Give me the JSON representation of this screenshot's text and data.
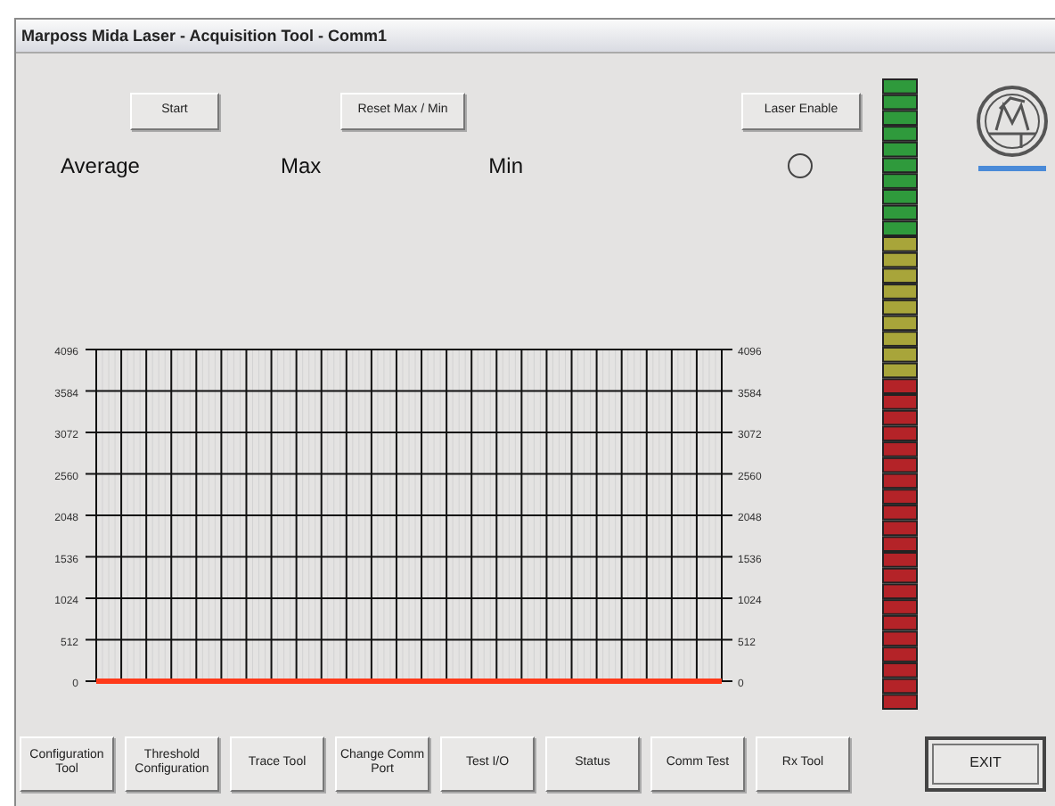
{
  "window": {
    "title": "Marposs Mida Laser - Acquisition Tool - Comm1"
  },
  "top_buttons": [
    "Start",
    "Reset Max / Min",
    "Laser Enable"
  ],
  "readouts": [
    "Average",
    "Max",
    "Min"
  ],
  "laser_lamp": {
    "on": false
  },
  "chart": {
    "chart_data": {
      "type": "line",
      "grid": true,
      "ylim": [
        0,
        4096
      ],
      "yticks": [
        0,
        512,
        1024,
        1536,
        2048,
        2560,
        3072,
        3584,
        4096
      ],
      "y2lim": [
        0,
        4096
      ],
      "y2ticks": [
        0,
        512,
        1024,
        1536,
        2048,
        2560,
        3072,
        3584,
        4096
      ],
      "series": [
        {
          "color": "#ff3a1a",
          "values": [
            0,
            0,
            0,
            0,
            0,
            0,
            0,
            0,
            0,
            0,
            0,
            0,
            0,
            0,
            0,
            0,
            0,
            0,
            0,
            0,
            0,
            0,
            0,
            0,
            0,
            0
          ]
        }
      ]
    }
  },
  "bottom_buttons": [
    {
      "label": "Configuration\nTool",
      "kind": "tool"
    },
    {
      "label": "Threshold\nConfiguration",
      "kind": "tool"
    },
    {
      "label": "Trace Tool",
      "kind": "tool"
    },
    {
      "label": "Change Comm\nPort",
      "kind": "tool"
    },
    {
      "label": "Test I/O",
      "kind": "tool"
    },
    {
      "label": "Status",
      "kind": "tool"
    },
    {
      "label": "Comm Test",
      "kind": "tool"
    },
    {
      "label": "Rx Tool",
      "kind": "tool"
    },
    {
      "label": "EXIT",
      "kind": "exit"
    }
  ]
}
